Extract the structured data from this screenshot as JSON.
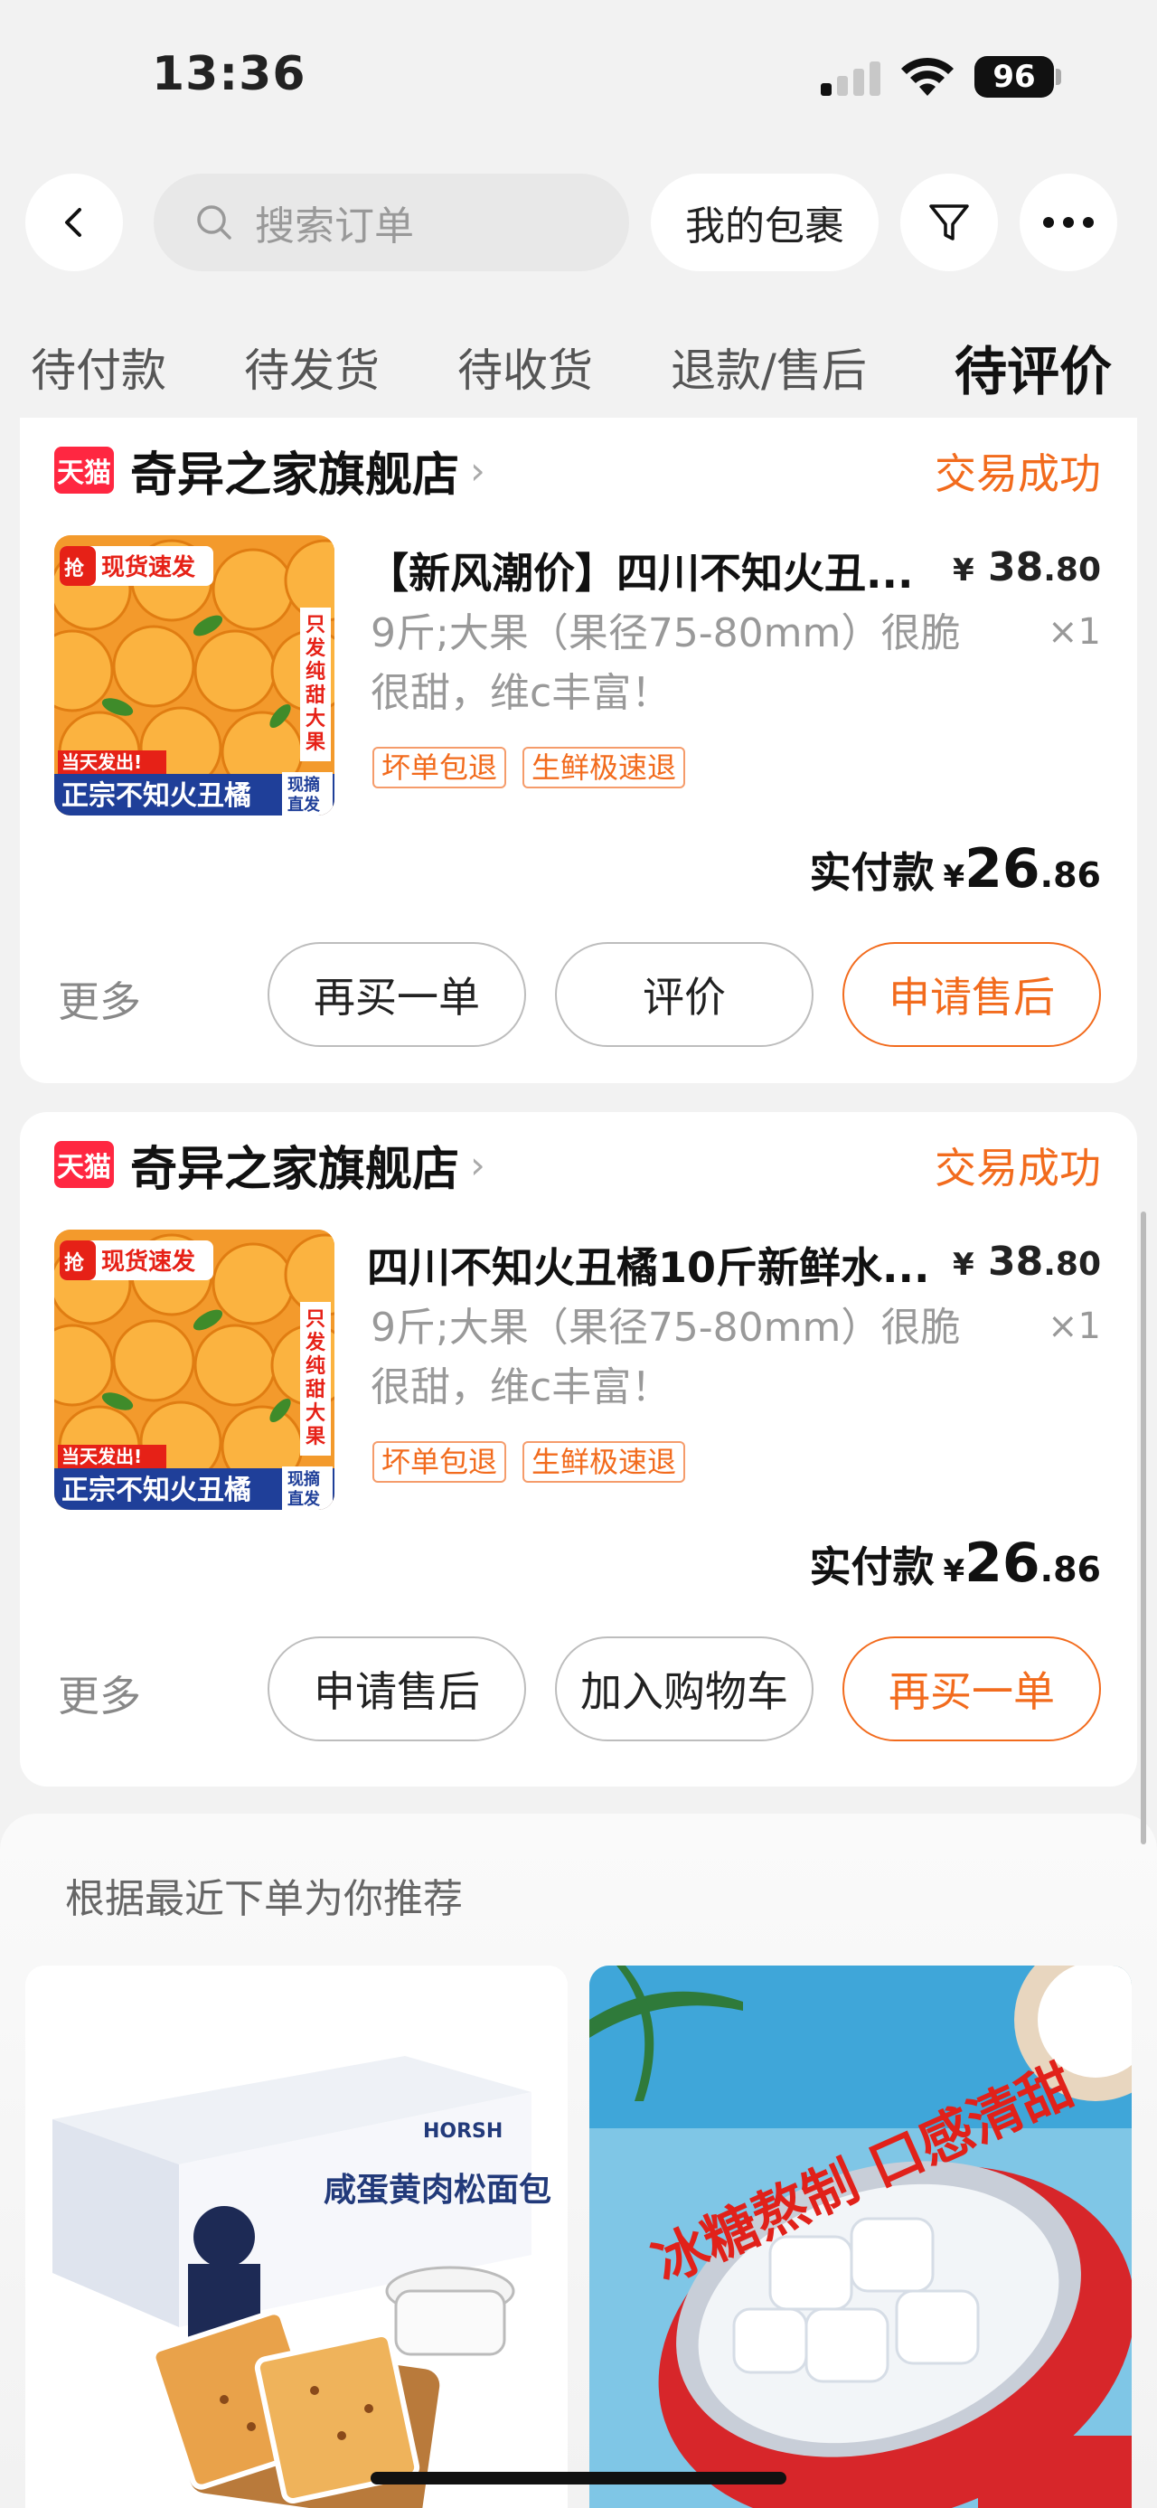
{
  "status_bar": {
    "time": "13:36",
    "battery": "96"
  },
  "search": {
    "placeholder": "搜索订单",
    "packages_label": "我的包裹"
  },
  "tabs": [
    {
      "label": "待付款"
    },
    {
      "label": "待发货"
    },
    {
      "label": "待收货"
    },
    {
      "label": "退款/售后"
    },
    {
      "label": "待评价"
    }
  ],
  "active_tab": "待评价",
  "orders": [
    {
      "badge": "天猫",
      "shop": "奇异之家旗舰店",
      "status": "交易成功",
      "title": "【新风潮价】四川不知火丑...",
      "price_currency": "¥",
      "price_int": "38",
      "price_cents": ".80",
      "sku": "9斤;大果（果径75-80mm）很脆很甜，维c丰富！",
      "qty": "×1",
      "tags": [
        "坏单包退",
        "生鲜极速退"
      ],
      "paid_label": "实付款",
      "paid_currency": "¥",
      "paid_int": "26",
      "paid_cents": ".86",
      "more": "更多",
      "buttons": [
        "再买一单",
        "评价",
        "申请售后"
      ],
      "thumb_text": {
        "top": "抢 现货速发",
        "side": "只发纯甜大果",
        "bottom": "正宗不知火丑橘",
        "corner": "现摘直发",
        "ribbon": "当天发出!"
      }
    },
    {
      "badge": "天猫",
      "shop": "奇异之家旗舰店",
      "status": "交易成功",
      "title": "四川不知火丑橘10斤新鲜水...",
      "price_currency": "¥",
      "price_int": "38",
      "price_cents": ".80",
      "sku": "9斤;大果（果径75-80mm）很脆很甜，维c丰富！",
      "qty": "×1",
      "tags": [
        "坏单包退",
        "生鲜极速退"
      ],
      "paid_label": "实付款",
      "paid_currency": "¥",
      "paid_int": "26",
      "paid_cents": ".86",
      "more": "更多",
      "buttons": [
        "申请售后",
        "加入购物车",
        "再买一单"
      ],
      "thumb_text": {
        "top": "抢 现货速发",
        "side": "只发纯甜大果",
        "bottom": "正宗不知火丑橘",
        "corner": "现摘直发",
        "ribbon": "当天发出!"
      }
    }
  ],
  "recommend": {
    "title": "根据最近下单为你推荐",
    "items": [
      {
        "image_text": "咸蛋黄肉松面包",
        "brand": "HORSH"
      },
      {
        "image_text": "冰糖熬制 口感清甜"
      }
    ]
  },
  "colors": {
    "accent": "#f26b1d",
    "tmall": "#ff2741",
    "page_bg": "#f2f2f2"
  }
}
